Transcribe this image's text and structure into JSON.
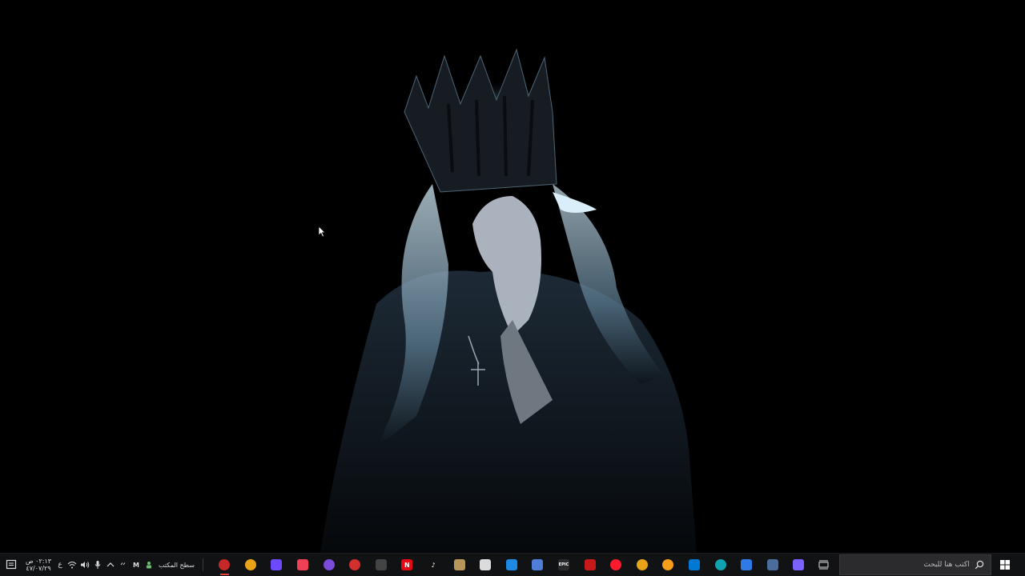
{
  "desktop": {
    "wallpaper_icon": "dark-crowned-figure-wallpaper",
    "cursor_icon": "arrow-cursor"
  },
  "taskbar": {
    "search_placeholder": "اكتب هنا للبحث",
    "desktop_label": "سطح المكتب",
    "language": "ع",
    "clock": {
      "time": "٠٢:١٣ ص",
      "date": "٤٧/٠٧/٢٩"
    },
    "accent_color": "#e0433b",
    "apps": [
      {
        "name": "chrome-red-icon",
        "color": "#c62828"
      },
      {
        "name": "chrome-icon",
        "color": "#e8a317"
      },
      {
        "name": "proton-vpn-icon",
        "color": "#6d4aff"
      },
      {
        "name": "pocket-icon",
        "color": "#ef4056"
      },
      {
        "name": "app-purple-icon",
        "color": "#7a4cd9"
      },
      {
        "name": "app-red-circle-icon",
        "color": "#d32f2f"
      },
      {
        "name": "media-player-icon",
        "color": "#444"
      },
      {
        "name": "netflix-icon",
        "color": "#e50914",
        "label": "N"
      },
      {
        "name": "tiktok-icon",
        "color": "#111",
        "label": "♪"
      },
      {
        "name": "pixel-game-icon",
        "color": "#b7955b"
      },
      {
        "name": "roblox-icon",
        "color": "#dcdcdc"
      },
      {
        "name": "app-blue-globe-icon",
        "color": "#1e88e5"
      },
      {
        "name": "shield-icon",
        "color": "#4f7dd8"
      },
      {
        "name": "epic-games-icon",
        "color": "#2a2a2a",
        "label": "EPIC"
      },
      {
        "name": "adobe-acrobat-icon",
        "color": "#c61a1a"
      },
      {
        "name": "opera-icon",
        "color": "#ff1b2d"
      },
      {
        "name": "chrome-icon-2",
        "color": "#e8a317"
      },
      {
        "name": "overwatch-icon",
        "color": "#f99e1a"
      },
      {
        "name": "microsoft-store-icon",
        "color": "#0078d4"
      },
      {
        "name": "edge-icon",
        "color": "#0fa3b1"
      },
      {
        "name": "mail-icon",
        "color": "#2f7be5"
      },
      {
        "name": "file-explorer-icon",
        "color": "#4a6d9c"
      },
      {
        "name": "copilot-icon",
        "color": "#7b61ff"
      }
    ]
  }
}
